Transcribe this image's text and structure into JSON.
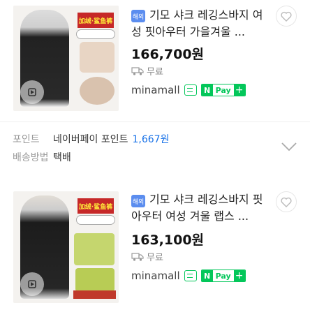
{
  "products": [
    {
      "badge": "해외",
      "title": "기모 샤크 레깅스바지 여성 핏아우터 가을겨울 ...",
      "price": "166,700원",
      "shipping": "무료",
      "seller": "minamall",
      "npay": {
        "n": "N",
        "pay": "Pay",
        "plus": "+"
      },
      "image_tag": "加绒·鲨鱼裤"
    },
    {
      "badge": "해외",
      "title": "기모 샤크 레깅스바지 핏아우터 여성 겨울 랩스 ...",
      "price": "163,100원",
      "shipping": "무료",
      "seller": "minamall",
      "npay": {
        "n": "N",
        "pay": "Pay",
        "plus": "+"
      },
      "image_tag": "加绒·鲨鱼裤"
    }
  ],
  "info": {
    "point_label": "포인트",
    "point_text": "네이버페이 포인트",
    "point_amount": "1,667원",
    "delivery_label": "배송방법",
    "delivery_value": "택배"
  },
  "colors": {
    "accent_blue": "#1a73e8",
    "badge_blue": "#5b8def",
    "npay_green": "#03c75a"
  },
  "icons": [
    "play-icon",
    "truck-icon",
    "chat-icon",
    "heart-icon",
    "chevron-down-icon"
  ]
}
